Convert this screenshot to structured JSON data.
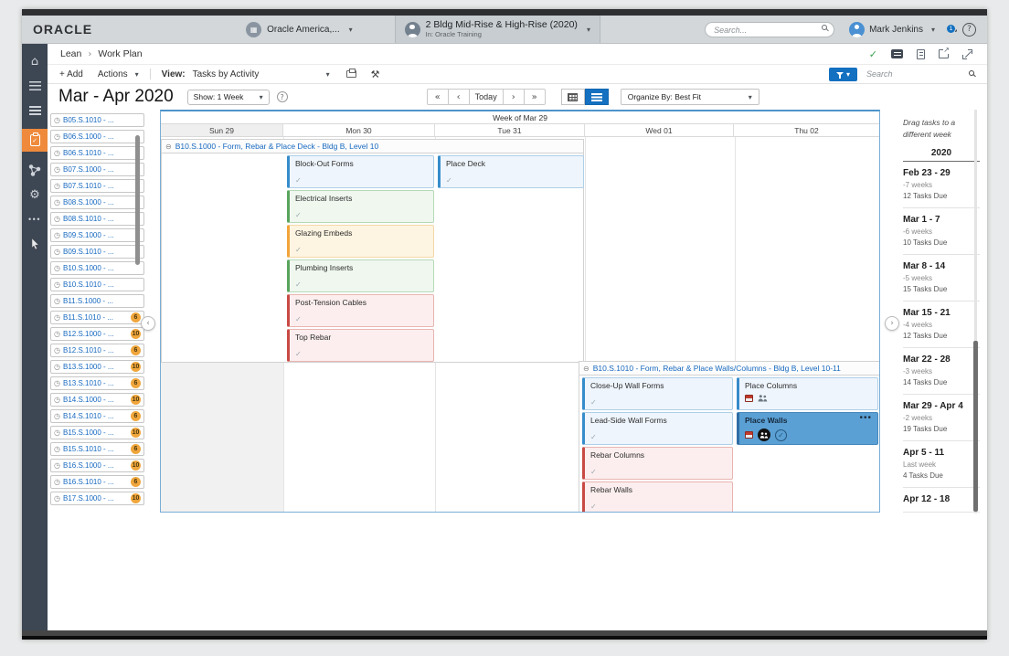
{
  "header": {
    "logo": "ORACLE",
    "org": {
      "label": "Oracle America,..."
    },
    "project": {
      "title": "2 Bldg Mid-Rise & High-Rise (2020)",
      "subtitle": "In: Oracle Training"
    },
    "search_placeholder": "Search...",
    "user": "Mark Jenkins",
    "notifications": "1"
  },
  "breadcrumb": {
    "section": "Lean",
    "page": "Work Plan"
  },
  "toolbar": {
    "add": "+ Add",
    "actions": "Actions",
    "view_label": "View:",
    "view_value": "Tasks by Activity",
    "search_placeholder": "Search"
  },
  "controls": {
    "title": "Mar - Apr 2020",
    "show": "Show: 1 Week",
    "today": "Today",
    "organize": "Organize By: Best Fit"
  },
  "icons": {
    "clock": "◷",
    "lane_status": "⊖",
    "check": "✓",
    "caret_down": "▾",
    "crumb_sep": "›",
    "prev_double": "«",
    "prev": "‹",
    "next": "›",
    "next_double": "»",
    "home": "⌂",
    "gear": "⚙",
    "more": "•••",
    "help": "?",
    "question": "?",
    "tools": "⚒",
    "export_arrow": "↗",
    "org_building": "▦",
    "ellipsis": "•••"
  },
  "task_list": {
    "items": [
      {
        "code": "B05.S.1010 - ...",
        "badge": ""
      },
      {
        "code": "B06.S.1000 - ...",
        "badge": ""
      },
      {
        "code": "B06.S.1010 - ...",
        "badge": ""
      },
      {
        "code": "B07.S.1000 - ...",
        "badge": ""
      },
      {
        "code": "B07.S.1010 - ...",
        "badge": ""
      },
      {
        "code": "B08.S.1000 - ...",
        "badge": ""
      },
      {
        "code": "B08.S.1010 - ...",
        "badge": ""
      },
      {
        "code": "B09.S.1000 - ...",
        "badge": ""
      },
      {
        "code": "B09.S.1010 - ...",
        "badge": ""
      },
      {
        "code": "B10.S.1000 - ...",
        "badge": ""
      },
      {
        "code": "B10.S.1010 - ...",
        "badge": ""
      },
      {
        "code": "B11.S.1000 - ...",
        "badge": ""
      },
      {
        "code": "B11.S.1010 - ...",
        "badge": "6"
      },
      {
        "code": "B12.S.1000 - ...",
        "badge": "10"
      },
      {
        "code": "B12.S.1010 - ...",
        "badge": "6"
      },
      {
        "code": "B13.S.1000 - ...",
        "badge": "10"
      },
      {
        "code": "B13.S.1010 - ...",
        "badge": "6"
      },
      {
        "code": "B14.S.1000 - ...",
        "badge": "10"
      },
      {
        "code": "B14.S.1010 - ...",
        "badge": "6"
      },
      {
        "code": "B15.S.1000 - ...",
        "badge": "10"
      },
      {
        "code": "B15.S.1010 - ...",
        "badge": "6"
      },
      {
        "code": "B16.S.1000 - ...",
        "badge": "10"
      },
      {
        "code": "B16.S.1010 - ...",
        "badge": "6"
      },
      {
        "code": "B17.S.1000 - ...",
        "badge": "10"
      }
    ]
  },
  "calendar": {
    "week_title": "Week of Mar 29",
    "days": [
      "Sun 29",
      "Mon 30",
      "Tue 31",
      "Wed 01",
      "Thu 02"
    ],
    "lanes": [
      {
        "title": "B10.S.1000 - Form, Rebar & Place Deck - Bldg B, Level 10",
        "mon": [
          {
            "title": "Block-Out Forms",
            "color": "blue"
          },
          {
            "title": "Electrical Inserts",
            "color": "green"
          },
          {
            "title": "Glazing Embeds",
            "color": "amber"
          },
          {
            "title": "Plumbing Inserts",
            "color": "green"
          },
          {
            "title": "Post-Tension Cables",
            "color": "red"
          },
          {
            "title": "Top Rebar",
            "color": "red"
          }
        ],
        "tue": [
          {
            "title": "Place Deck",
            "color": "blue"
          }
        ]
      },
      {
        "title": "B10.S.1010 - Form, Rebar & Place Walls/Columns - Bldg B, Level 10-11",
        "wed": [
          {
            "title": "Close-Up Wall Forms",
            "color": "blue"
          },
          {
            "title": "Lead-Side Wall Forms",
            "color": "blue"
          },
          {
            "title": "Rebar Columns",
            "color": "red"
          },
          {
            "title": "Rebar Walls",
            "color": "red"
          }
        ],
        "thu": [
          {
            "title": "Place Columns",
            "color": "blue"
          },
          {
            "title": "Place Walls",
            "color": "blue",
            "selected": true
          }
        ]
      }
    ]
  },
  "week_panel": {
    "hint": "Drag tasks to a different week",
    "year": "2020",
    "weeks": [
      {
        "range": "Feb 23 - 29",
        "offset": "-7 weeks",
        "due": "12 Tasks Due"
      },
      {
        "range": "Mar 1 - 7",
        "offset": "-6 weeks",
        "due": "10 Tasks Due"
      },
      {
        "range": "Mar 8 - 14",
        "offset": "-5 weeks",
        "due": "15 Tasks Due"
      },
      {
        "range": "Mar 15 - 21",
        "offset": "-4 weeks",
        "due": "12 Tasks Due"
      },
      {
        "range": "Mar 22 - 28",
        "offset": "-3 weeks",
        "due": "14 Tasks Due"
      },
      {
        "range": "Mar 29 - Apr 4",
        "offset": "-2 weeks",
        "due": "19 Tasks Due"
      },
      {
        "range": "Apr 5 - 11",
        "offset": "Last week",
        "due": "4 Tasks Due"
      },
      {
        "range": "Apr 12 - 18",
        "offset": "",
        "due": ""
      }
    ]
  },
  "colors": {
    "accent_blue": "#1470c0",
    "nav_slate": "#3d4653",
    "active_orange": "#ef8a3c",
    "badge_orange": "#f0a63c",
    "selected_card": "#5ba0d4",
    "status_blue": "#368ccb",
    "status_green": "#58a55c",
    "status_amber": "#f2a53a",
    "status_red": "#c94a44",
    "weekend_grey": "#f1f1f1"
  }
}
